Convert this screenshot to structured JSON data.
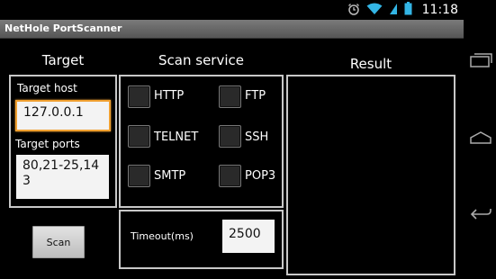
{
  "status": {
    "time": "11:18"
  },
  "app": {
    "title": "NetHole PortScanner"
  },
  "target": {
    "heading": "Target",
    "host_label": "Target host",
    "host_value": "127.0.0.1",
    "ports_label": "Target ports",
    "ports_value_line1": "80,21-25,14",
    "ports_value_line2": "3"
  },
  "scan_service": {
    "heading": "Scan service",
    "services": [
      "HTTP",
      "FTP",
      "TELNET",
      "SSH",
      "SMTP",
      "POP3"
    ],
    "timeout_label": "Timeout(ms)",
    "timeout_value": "2500"
  },
  "result": {
    "heading": "Result"
  },
  "actions": {
    "scan_label": "Scan"
  }
}
